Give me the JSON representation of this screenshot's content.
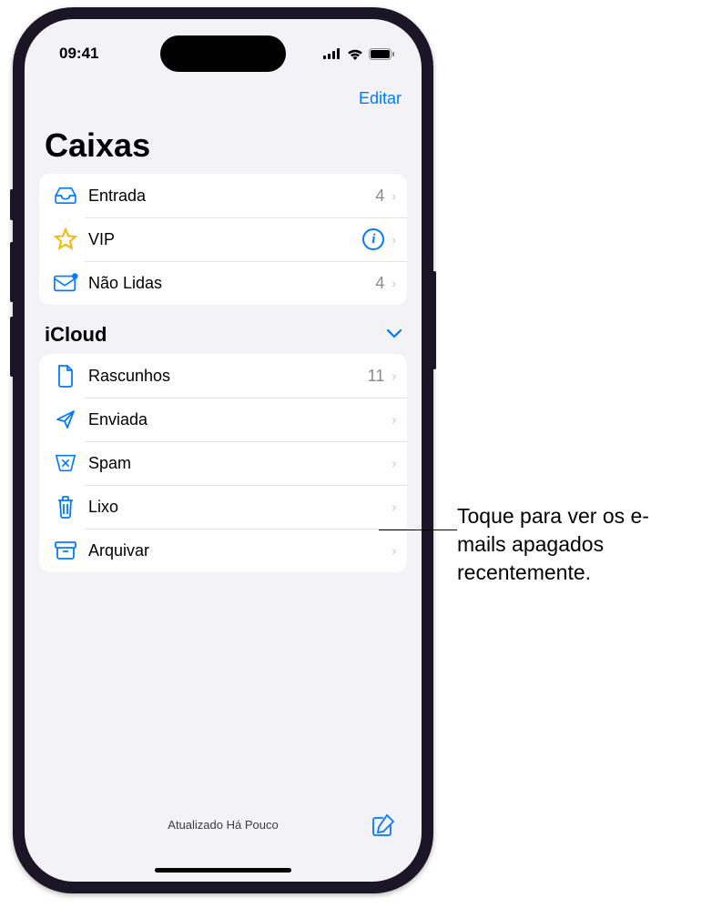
{
  "status": {
    "time": "09:41"
  },
  "nav": {
    "edit": "Editar"
  },
  "title": "Caixas",
  "top_rows": [
    {
      "label": "Entrada",
      "count": "4"
    },
    {
      "label": "VIP"
    },
    {
      "label": "Não Lidas",
      "count": "4"
    }
  ],
  "section": {
    "title": "iCloud"
  },
  "icloud_rows": [
    {
      "label": "Rascunhos",
      "count": "11"
    },
    {
      "label": "Enviada"
    },
    {
      "label": "Spam"
    },
    {
      "label": "Lixo"
    },
    {
      "label": "Arquivar"
    }
  ],
  "toolbar": {
    "status": "Atualizado Há Pouco"
  },
  "callout": "Toque para ver os e-mails apagados recentemente."
}
